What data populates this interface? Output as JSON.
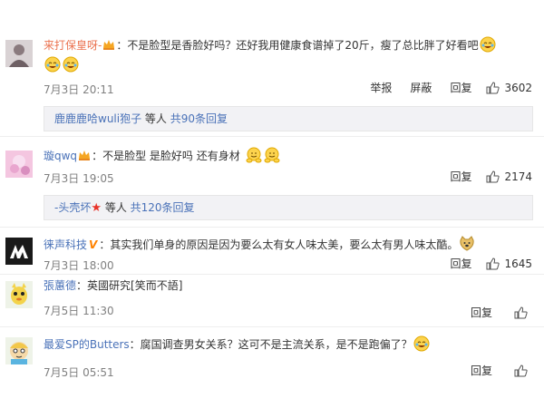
{
  "comments": [
    {
      "username": "来打保皇呀-",
      "text1": "：不是脸型是香脸好吗？还好我用健康食谱掉了20斤，瘦了总比胖了好看吧",
      "time": "7月3日 20:11",
      "actions": [
        "举报",
        "屏蔽",
        "回复"
      ],
      "likes": "3602",
      "reply_summary": {
        "names": "鹿鹿鹿哈wuli狍子",
        "middle": " 等人 ",
        "count": "共90条回复"
      }
    },
    {
      "username": "璇qwq",
      "text1": "：不是脸型 是脸好吗 还有身材",
      "time": "7月3日 19:05",
      "actions": [
        "回复"
      ],
      "likes": "2174",
      "reply_summary": {
        "names": "-头壳坏",
        "middle": " 等人 ",
        "count": "共120条回复"
      }
    },
    {
      "username": "徕声科技",
      "text1": "：其实我们单身的原因是因为要么太有女人味太美，要么太有男人味太酷。",
      "time": "7月3日 18:00",
      "actions": [
        "回复"
      ],
      "likes": "1645"
    },
    {
      "username": "張蕙德",
      "text1": "：英國研究[笑而不語]",
      "time": "7月5日 11:30",
      "actions": [
        "回复"
      ]
    },
    {
      "username": "最爱SP的Butters",
      "text1": "：腐国调查男女关系？这可不是主流关系，是不是跑偏了？",
      "time": "7月5日 05:51",
      "actions": [
        "回复"
      ]
    }
  ],
  "colors": {
    "username": "#eb7350",
    "link": "#4a72b8",
    "meta": "#808080",
    "reply_bg": "#f2f2f5"
  }
}
